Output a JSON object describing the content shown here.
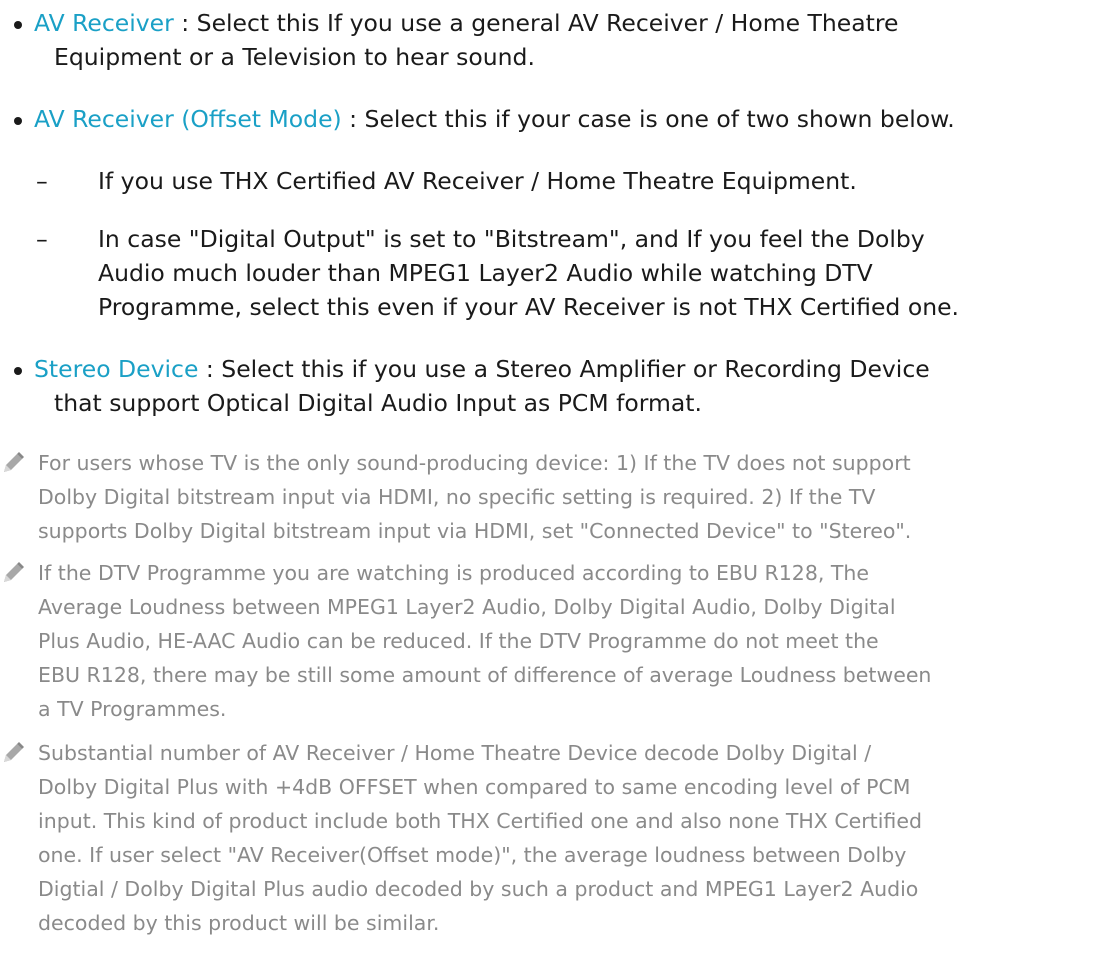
{
  "items": [
    {
      "term": "AV Receiver",
      "lines": [
        " : Select this If you use a general AV Receiver / Home Theatre",
        "Equipment or a Television to hear sound."
      ]
    },
    {
      "term": "AV Receiver (Offset Mode)",
      "lines": [
        " : Select this if your case is one of two shown below."
      ],
      "subitems": [
        {
          "dash": "–",
          "lines": [
            "If you use THX Certified AV Receiver / Home Theatre Equipment."
          ]
        },
        {
          "dash": "–",
          "lines": [
            "In case \"Digital Output\" is set to \"Bitstream\", and If you feel the Dolby",
            "Audio much louder than MPEG1 Layer2 Audio while watching DTV",
            "Programme, select this even if your AV Receiver is not THX Certified one."
          ]
        }
      ]
    },
    {
      "term": "Stereo Device",
      "lines": [
        " : Select this if you use a Stereo Amplifier or Recording Device",
        "that support Optical Digital Audio Input as PCM format."
      ]
    }
  ],
  "notes": [
    {
      "icon": "pencil-icon",
      "lines": [
        "For users whose TV is the only sound-producing device: 1) If the TV does not support",
        "Dolby Digital bitstream input via HDMI, no specific setting is required. 2) If the TV",
        "supports Dolby Digital bitstream input via HDMI, set \"Connected Device\" to \"Stereo\"."
      ]
    },
    {
      "icon": "pencil-icon",
      "lines": [
        "If the DTV Programme you are watching is produced according to EBU R128, The",
        "Average Loudness between MPEG1 Layer2 Audio, Dolby Digital Audio, Dolby Digital",
        "Plus Audio, HE-AAC Audio can be reduced. If the DTV Programme do not meet the",
        "EBU R128, there may be still some amount of difference of average Loudness between",
        "a TV Programmes."
      ]
    },
    {
      "icon": "pencil-icon",
      "lines": [
        "Substantial number of AV Receiver / Home Theatre Device decode Dolby Digital /",
        "Dolby Digital Plus with +4dB OFFSET when compared to same encoding level of PCM",
        "input. This kind of product include both THX Certified one and also none THX Certified",
        "one. If user select \"AV Receiver(Offset mode)\", the average loudness between Dolby",
        "Digtial / Dolby Digital Plus audio decoded by such a product and MPEG1 Layer2 Audio",
        "decoded by this product will be similar."
      ]
    }
  ],
  "colors": {
    "term": "#1aa0c6",
    "body_text": "#1a1a1a",
    "note_text": "#8a8a8a"
  }
}
